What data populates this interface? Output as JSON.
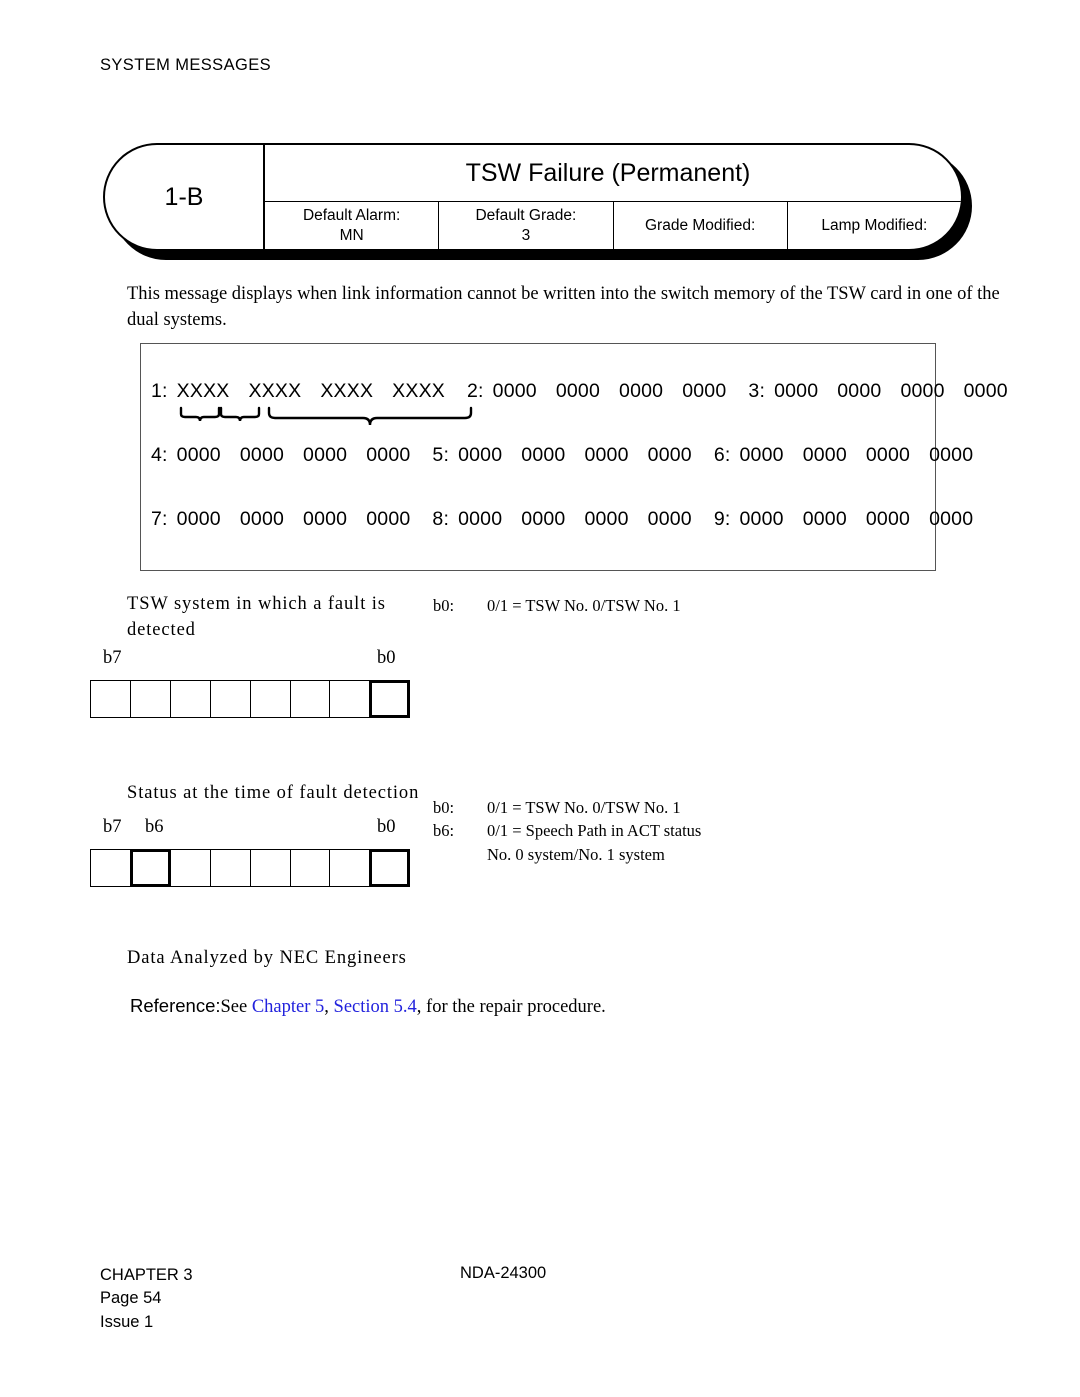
{
  "running_head": "SYSTEM MESSAGES",
  "plate": {
    "code": "1-B",
    "title": "TSW Failure (Permanent)",
    "fields": [
      {
        "label": "Default Alarm:",
        "value": "MN"
      },
      {
        "label": "Default Grade:",
        "value": "3"
      },
      {
        "label": "Grade Modified:",
        "value": ""
      },
      {
        "label": "Lamp Modified:",
        "value": ""
      }
    ]
  },
  "description": "This message displays when link information cannot be written into the switch memory of the TSW card in one of the dual systems.",
  "data_frame": {
    "rows": [
      {
        "groups": [
          {
            "index": "1:",
            "words": [
              "XXXX",
              "XXXX",
              "XXXX",
              "XXXX"
            ]
          },
          {
            "index": "2:",
            "words": [
              "0000",
              "0000",
              "0000",
              "0000"
            ]
          },
          {
            "index": "3:",
            "words": [
              "0000",
              "0000",
              "0000",
              "0000"
            ]
          }
        ]
      },
      {
        "groups": [
          {
            "index": "4:",
            "words": [
              "0000",
              "0000",
              "0000",
              "0000"
            ]
          },
          {
            "index": "5:",
            "words": [
              "0000",
              "0000",
              "0000",
              "0000"
            ]
          },
          {
            "index": "6:",
            "words": [
              "0000",
              "0000",
              "0000",
              "0000"
            ]
          }
        ]
      },
      {
        "groups": [
          {
            "index": "7:",
            "words": [
              "0000",
              "0000",
              "0000",
              "0000"
            ]
          },
          {
            "index": "8:",
            "words": [
              "0000",
              "0000",
              "0000",
              "0000"
            ]
          },
          {
            "index": "9:",
            "words": [
              "0000",
              "0000",
              "0000",
              "0000"
            ]
          }
        ]
      }
    ]
  },
  "bitfields": [
    {
      "caption": "TSW system in which a fault is detected",
      "left_label": "b7",
      "mid_label": "",
      "right_label": "b0",
      "cells": [
        {
          "bit": "b7",
          "highlight": false
        },
        {
          "bit": "b6",
          "highlight": false
        },
        {
          "bit": "b5",
          "highlight": false
        },
        {
          "bit": "b4",
          "highlight": false
        },
        {
          "bit": "b3",
          "highlight": false
        },
        {
          "bit": "b2",
          "highlight": false
        },
        {
          "bit": "b1",
          "highlight": false
        },
        {
          "bit": "b0",
          "highlight": true
        }
      ],
      "notes": [
        {
          "key": "b0:",
          "value": "0/1 = TSW No. 0/TSW No. 1",
          "cont": ""
        }
      ]
    },
    {
      "caption": "Status at the time of fault detection",
      "left_label": "b7",
      "mid_label": "b6",
      "right_label": "b0",
      "cells": [
        {
          "bit": "b7",
          "highlight": false
        },
        {
          "bit": "b6",
          "highlight": true
        },
        {
          "bit": "b5",
          "highlight": false
        },
        {
          "bit": "b4",
          "highlight": false
        },
        {
          "bit": "b3",
          "highlight": false
        },
        {
          "bit": "b2",
          "highlight": false
        },
        {
          "bit": "b1",
          "highlight": false
        },
        {
          "bit": "b0",
          "highlight": true
        }
      ],
      "notes": [
        {
          "key": "b0:",
          "value": "0/1 = TSW No. 0/TSW No. 1",
          "cont": ""
        },
        {
          "key": "b6:",
          "value": "0/1 = Speech Path in ACT status",
          "cont": "No. 0 system/No. 1 system"
        }
      ]
    }
  ],
  "analyzed_note": "Data Analyzed by NEC Engineers",
  "reference": {
    "label": "Reference:",
    "prefix": "See ",
    "link1": "Chapter 5",
    "separator": ", ",
    "link2": "Section 5.4",
    "suffix": ", for the repair procedure."
  },
  "footer": {
    "chapter": "CHAPTER 3",
    "page": "Page 54",
    "issue": "Issue 1",
    "document": "NDA-24300"
  },
  "colors": {
    "link": "#2222dd",
    "ink": "#000000"
  }
}
